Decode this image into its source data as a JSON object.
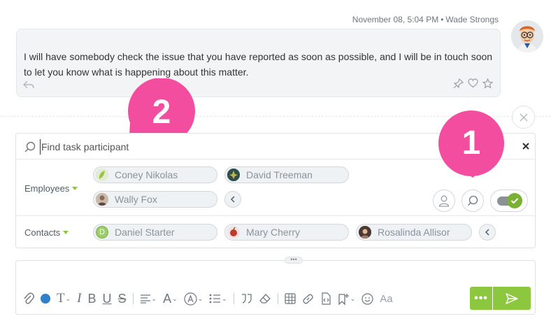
{
  "message": {
    "date": "November 08, 5:04 PM",
    "separator": "•",
    "author": "Wade Strongs",
    "text": "I will have somebody check the issue that you have reported as soon as possible, and I will be in touch soon to let you know what is happening about this matter."
  },
  "participants": {
    "search_placeholder": "Find task participant",
    "employees_label": "Employees",
    "contacts_label": "Contacts",
    "employees": [
      {
        "name": "Coney Nikolas",
        "avatar_color": "#9bc34a"
      },
      {
        "name": "David Treeman",
        "avatar_color": "#3d6e6a"
      },
      {
        "name": "Wally Fox",
        "avatar_color": "#a08070"
      }
    ],
    "contacts": [
      {
        "name": "Daniel Starter",
        "initial": "D",
        "avatar_color": "#9ccd6b"
      },
      {
        "name": "Mary Cherry",
        "avatar_color": "#c0392b"
      },
      {
        "name": "Rosalinda Allisor",
        "avatar_color": "#7a5c4e"
      }
    ]
  },
  "callouts": {
    "one": "1",
    "two": "2",
    "color": "#f24d9f"
  },
  "editor": {
    "font_size_label": "Aa",
    "more_label": "•••"
  },
  "colors": {
    "accent_green": "#8dc63f",
    "toggle_green": "#7ab134",
    "color_dot": "#2f80c8"
  }
}
